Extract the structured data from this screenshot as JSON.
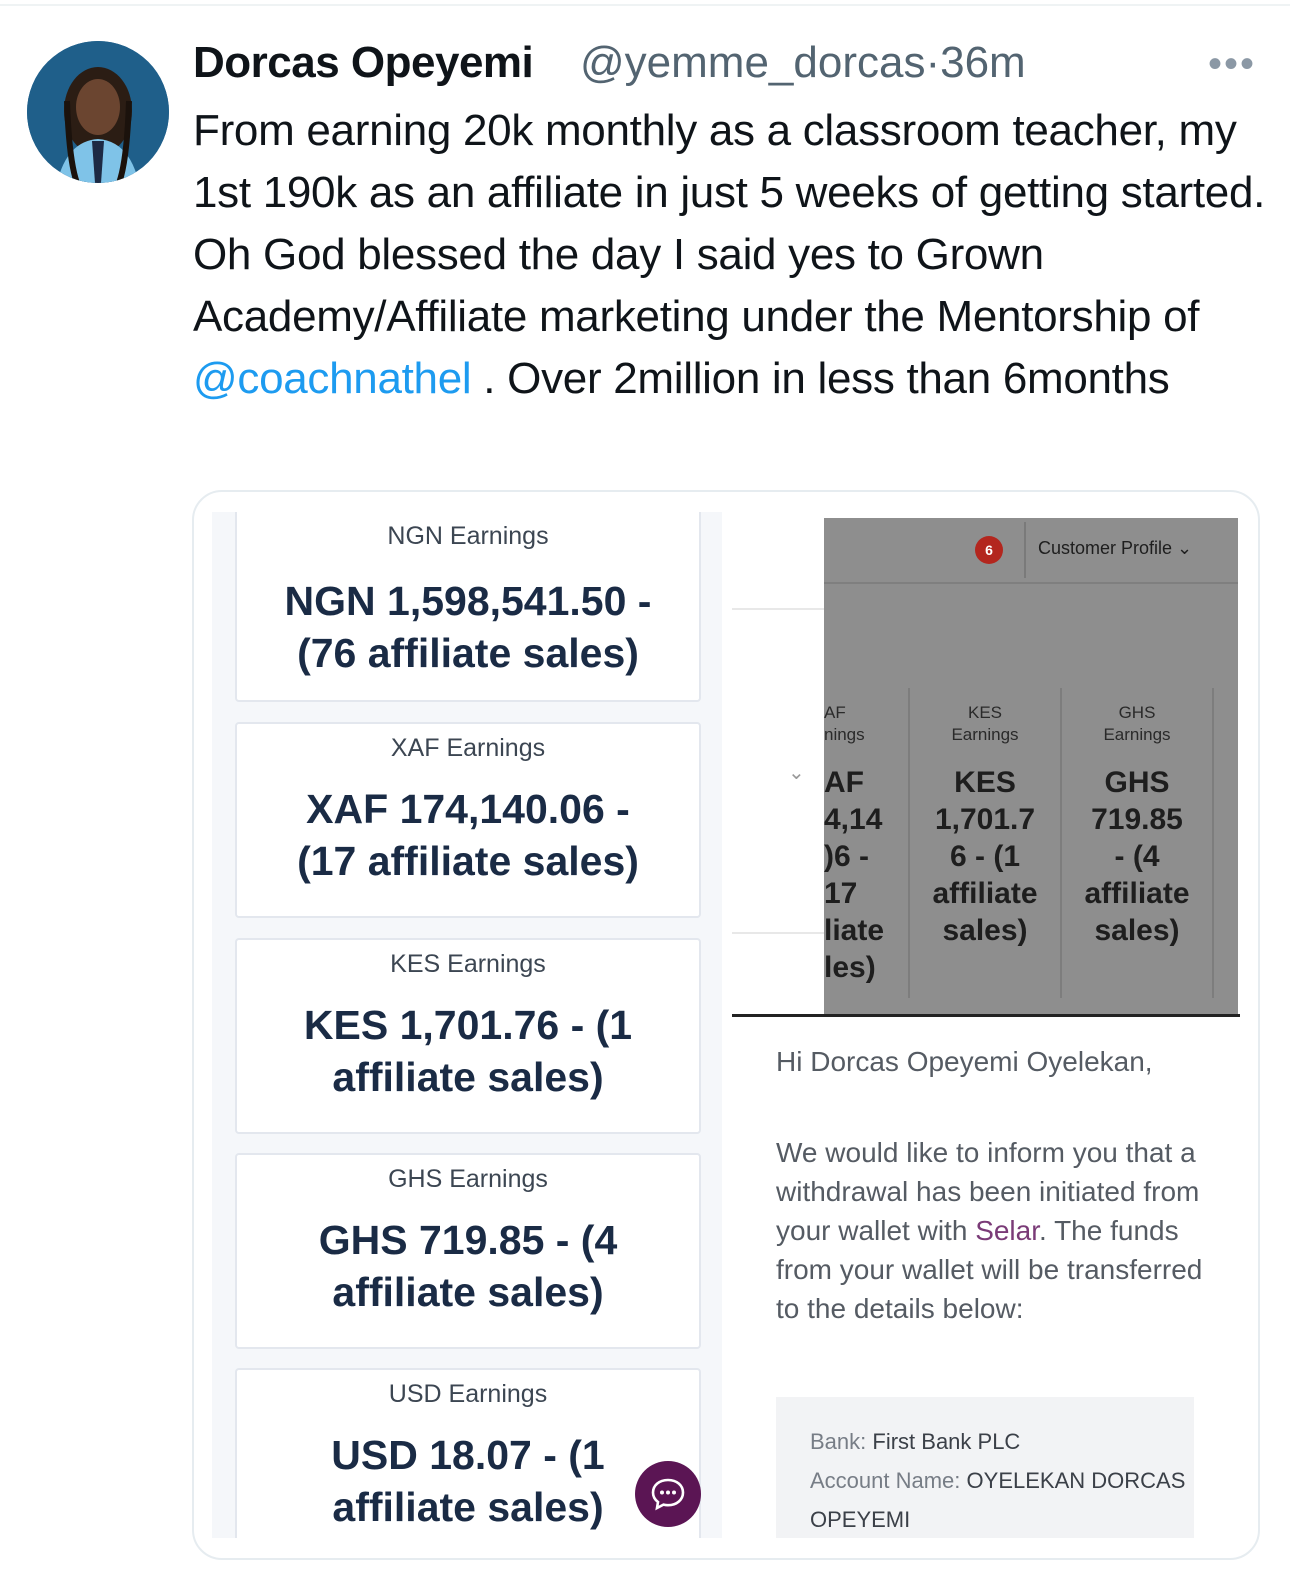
{
  "tweet": {
    "author_name": "Dorcas Opeyemi",
    "author_handle": "@yemme_dorcas",
    "separator": "·",
    "time": "36m",
    "more": "•••",
    "text_part1": "From earning 20k monthly as a classroom teacher, my 1st 190k as an affiliate in just 5 weeks of getting started. Oh God blessed the day I said yes to Grown Academy/Affiliate marketing under the Mentorship of ",
    "mention": "@coachnathel",
    "text_part2": " . Over 2million in less than 6months"
  },
  "earnings_cards": [
    {
      "label": "NGN Earnings",
      "value": "NGN 1,598,541.50 - (76 affiliate sales)"
    },
    {
      "label": "XAF Earnings",
      "value": "XAF 174,140.06 - (17 affiliate sales)"
    },
    {
      "label": "KES Earnings",
      "value": "KES 1,701.76 - (1 affiliate sales)"
    },
    {
      "label": "GHS Earnings",
      "value": "GHS 719.85 - (4 affiliate sales)"
    },
    {
      "label": "USD Earnings",
      "value": "USD 18.07 - (1 affiliate sales)"
    }
  ],
  "dashboard": {
    "notification_count": "6",
    "customer_profile": "Customer Profile ⌄",
    "chevron": "⌄",
    "columns": [
      {
        "head": "AF\nnings",
        "value": "AF\n4,14\n)6 -\n17\nliate\nles)"
      },
      {
        "head": "KES\nEarnings",
        "value": "KES\n1,701.7\n6 - (1\naffiliate\nsales)"
      },
      {
        "head": "GHS\nEarnings",
        "value": "GHS\n719.85\n- (4\naffiliate\nsales)"
      }
    ]
  },
  "email": {
    "greeting": "Hi Dorcas Opeyemi Oyelekan,",
    "body_part1": "We would like to inform you that a withdrawal has been initiated from your wallet with ",
    "selar": "Selar",
    "body_part2": ". The funds from your wallet will be transferred to the details below:",
    "bank_label": "Bank:",
    "bank_value": "First Bank PLC",
    "account_label": "Account Name:",
    "account_value": "OYELEKAN DORCAS OPEYEMI"
  },
  "colors": {
    "mention": "#1d9bf0",
    "card_value": "#1a2b45",
    "chat_button": "#5b1554",
    "badge": "#b3261e",
    "selar_link": "#7a3b77"
  }
}
